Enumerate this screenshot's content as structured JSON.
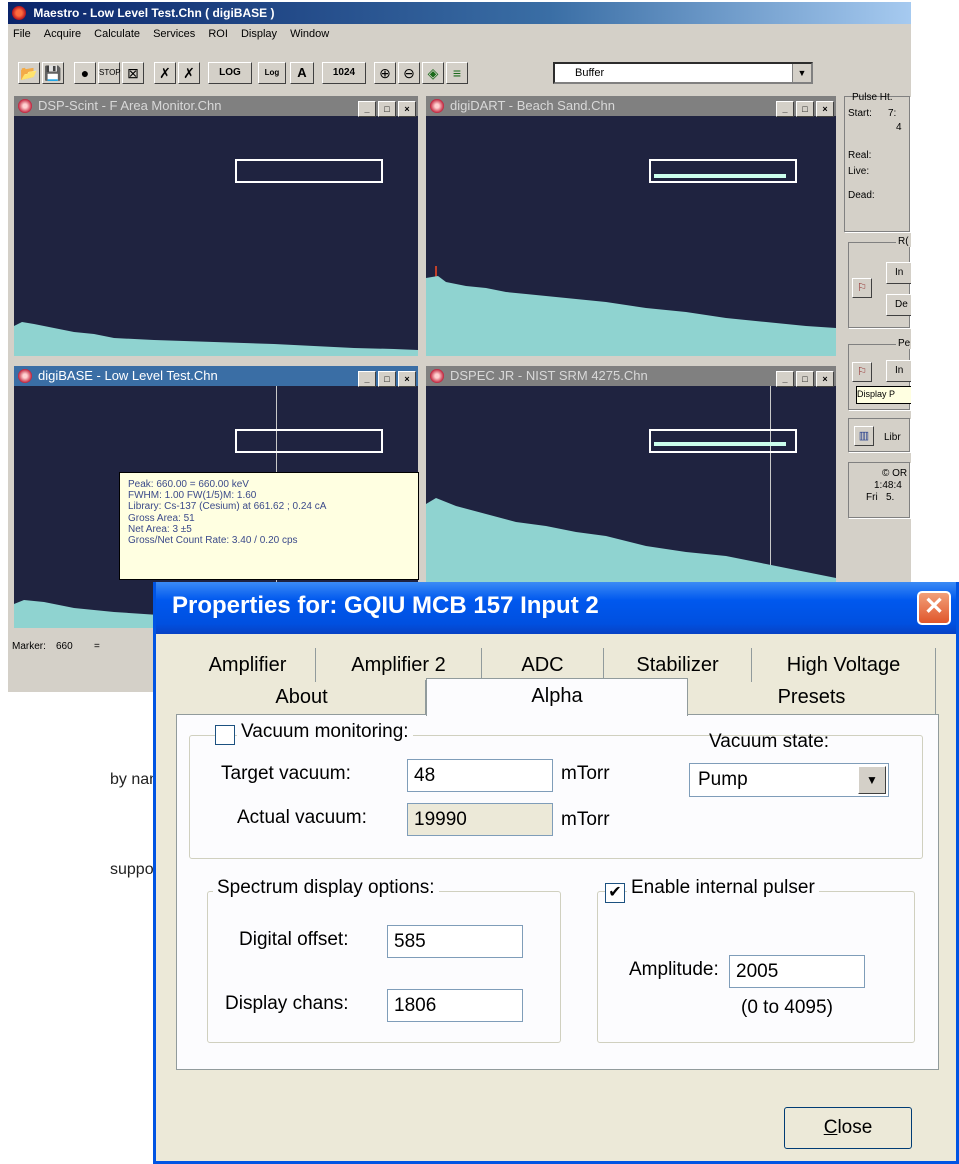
{
  "app": {
    "title": "Maestro - Low Level Test.Chn ( digiBASE )",
    "menu": [
      "File",
      "Acquire",
      "Calculate",
      "Services",
      "ROI",
      "Display",
      "Window"
    ]
  },
  "toolbar": {
    "log_button": "LOG",
    "log_small_label": "Log",
    "auto_button": "A",
    "scale_button": "1024",
    "buffer_select": "Buffer"
  },
  "spectra": [
    {
      "title": "DSP-Scint - F Area Monitor.Chn",
      "active": false
    },
    {
      "title": "digiDART - Beach Sand.Chn",
      "active": false
    },
    {
      "title": "digiBASE - Low Level Test.Chn",
      "active": true
    },
    {
      "title": "DSPEC JR - NIST SRM 4275.Chn",
      "active": false
    }
  ],
  "window_buttons": {
    "minimize": "_",
    "maximize": "□",
    "close": "×"
  },
  "peak_tooltip": {
    "line1": "Peak: 660.00 = 660.00 keV",
    "line2": "FWHM: 1.00  FW(1/5)M: 1.60",
    "line3": "Library: Cs-137 (Cesium) at 661.62 ;  0.24 cA",
    "line4": "Gross Area: 51",
    "line5": "Net Area: 3 ±5",
    "line6": "Gross/Net Count Rate: 3.40 / 0.20 cps"
  },
  "right_panel": {
    "pulse_ht": "Pulse Ht.",
    "start_label": "Start:",
    "start_value": "7:",
    "start_value2": "4",
    "real_label": "Real:",
    "live_label": "Live:",
    "dead_label": "Dead:",
    "roi_header": "R(",
    "roi_btn1": "In",
    "roi_btn2": "De",
    "peak_header": "Pe",
    "peak_btn": "In",
    "display_tip": "Display P",
    "library_btn": "Libr",
    "ortec": "© OR",
    "time": "1:48:4",
    "date": "Fri   5."
  },
  "status": {
    "marker_label": "Marker:",
    "marker_value": "660",
    "marker_eq": "="
  },
  "cut_text": {
    "line1": "by name,",
    "line2": "support"
  },
  "dialog": {
    "title": "Properties for: GQIU MCB 157 Input 2",
    "close_x": "✕",
    "tabs_row1": [
      "Amplifier",
      "Amplifier 2",
      "ADC",
      "Stabilizer",
      "High Voltage"
    ],
    "tabs_row2": [
      "About",
      "Alpha",
      "Presets"
    ],
    "selected_tab": "Alpha",
    "vacuum_monitoring": {
      "label": "Vacuum monitoring:",
      "checked": false
    },
    "target_vacuum": {
      "label": "Target vacuum:",
      "value": "48",
      "unit": "mTorr"
    },
    "actual_vacuum": {
      "label": "Actual vacuum:",
      "value": "19990",
      "unit": "mTorr"
    },
    "vacuum_state": {
      "label": "Vacuum state:",
      "value": "Pump"
    },
    "spectrum_display": {
      "label": "Spectrum display options:",
      "digital_offset_label": "Digital offset:",
      "digital_offset": "585",
      "display_chans_label": "Display chans:",
      "display_chans": "1806"
    },
    "pulser": {
      "label": "Enable internal pulser",
      "checked": true,
      "amplitude_label": "Amplitude:",
      "amplitude": "2005",
      "range": "(0 to 4095)"
    },
    "close_button_first": "C",
    "close_button_rest": "lose"
  },
  "colors": {
    "spectrum_bg": "#1f2340",
    "spectrum_fill": "#8fd3d0",
    "dialog_title": "#0058ee"
  }
}
